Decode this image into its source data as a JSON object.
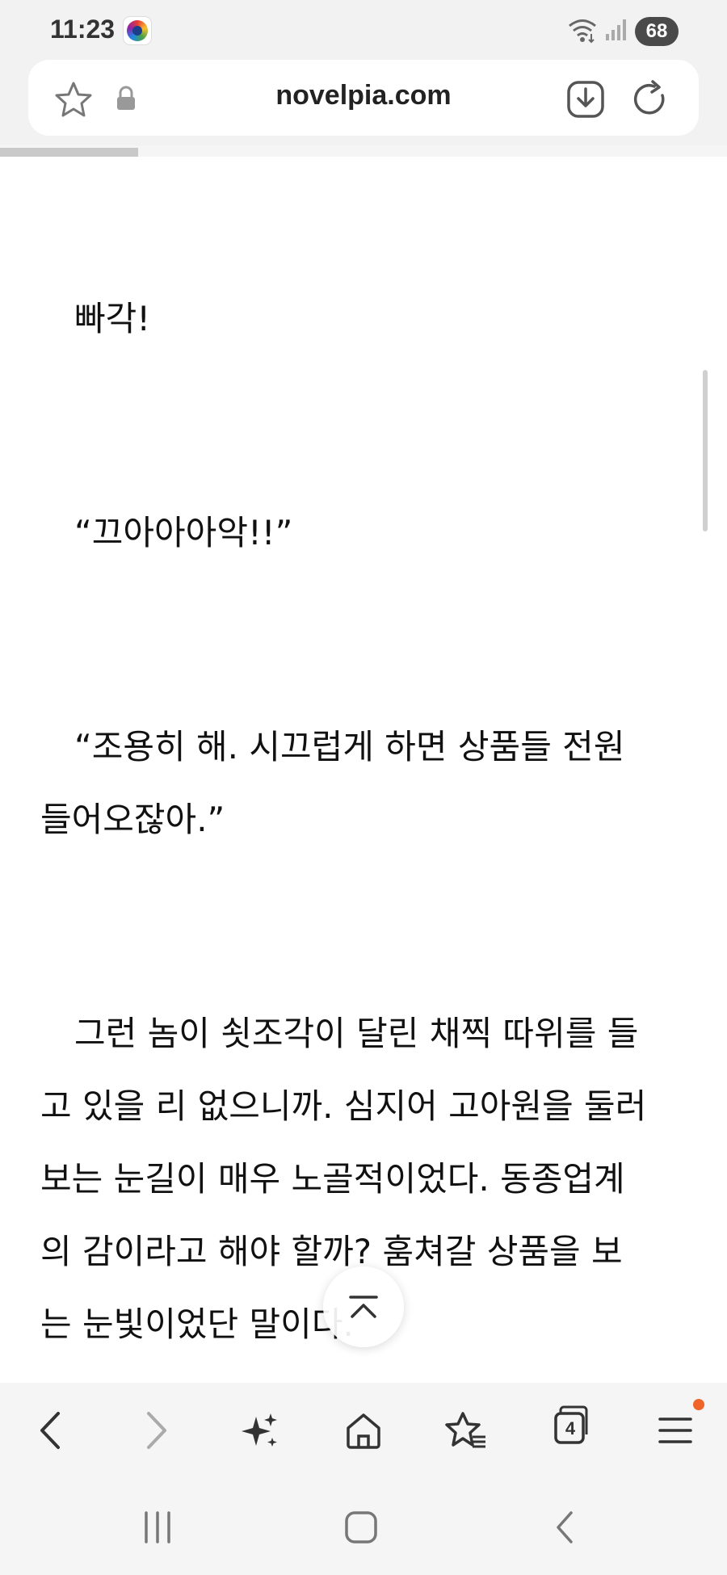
{
  "status_bar": {
    "time": "11:23",
    "battery": "68",
    "icons": [
      "map-app-icon",
      "wifi-icon",
      "signal-icon",
      "battery-icon"
    ]
  },
  "address_bar": {
    "url": "novelpia.com",
    "icons": [
      "star-outline-icon",
      "lock-icon",
      "download-icon",
      "reload-icon"
    ]
  },
  "page_load_progress": 0.19,
  "reader": {
    "paragraphs": [
      [
        "　빠각!"
      ],
      [
        "　“끄아아아악!!”"
      ],
      [
        "　“조용히 해. 시끄럽게 하면 상품들 전원",
        "들어오잖아.”"
      ],
      [
        "　그런 놈이 쇳조각이 달린 채찍 따위를 들",
        "고 있을 리 없으니까. 심지어 고아원을 둘러",
        "보는 눈길이 매우 노골적이었다. 동종업계",
        "의 감이라고 해야 할까? 훔쳐갈 상품을 보",
        "는 눈빛이었단 말이다."
      ]
    ]
  },
  "bottom_toolbar": {
    "tab_count": "4",
    "icons": [
      "back-arrow-icon",
      "forward-arrow-icon",
      "sparkle-icon",
      "home-icon",
      "bookmarks-icon",
      "tabs-icon",
      "menu-icon"
    ]
  },
  "nav_bar": {
    "icons": [
      "recent-apps-icon",
      "home-square-icon",
      "back-chevron-icon"
    ]
  },
  "colors": {
    "chrome_bg": "#f2f2f2",
    "text": "#111111",
    "notification_dot": "#f0642a"
  }
}
